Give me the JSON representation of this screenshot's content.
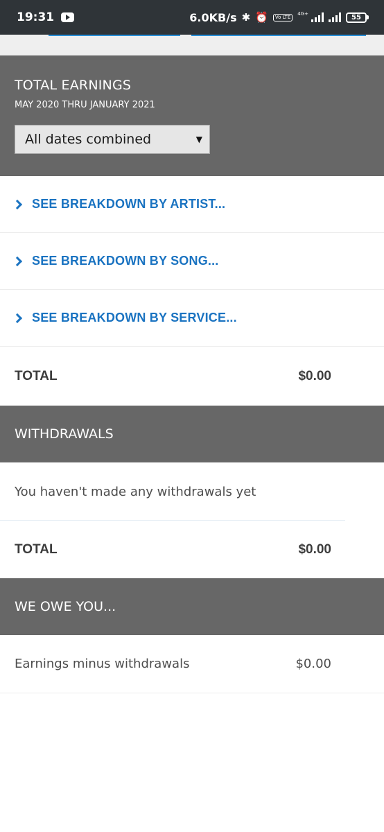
{
  "status_bar": {
    "time": "19:31",
    "speed": "6.0KB/s",
    "volte": "Vo LTE",
    "network": "4G+",
    "battery": "55",
    "icons": [
      "youtube-icon",
      "bluetooth-icon",
      "alarm-icon",
      "volte-icon",
      "signal-icon",
      "battery-icon"
    ]
  },
  "earnings": {
    "title": "TOTAL EARNINGS",
    "subtitle": "MAY 2020 THRU JANUARY 2021",
    "date_filter": "All dates combined",
    "breakdowns": [
      {
        "label": "SEE BREAKDOWN BY ARTIST..."
      },
      {
        "label": "SEE BREAKDOWN BY SONG..."
      },
      {
        "label": "SEE BREAKDOWN BY SERVICE..."
      }
    ],
    "total_label": "TOTAL",
    "total_value": "$0.00"
  },
  "withdrawals": {
    "title": "WITHDRAWALS",
    "empty_message": "You haven't made any withdrawals yet",
    "total_label": "TOTAL",
    "total_value": "$0.00"
  },
  "owed": {
    "title": "WE OWE YOU...",
    "label": "Earnings minus withdrawals",
    "value": "$0.00"
  },
  "colors": {
    "header_bg": "#676767",
    "link": "#1a73c1",
    "status_bar_bg": "#2f3438"
  }
}
